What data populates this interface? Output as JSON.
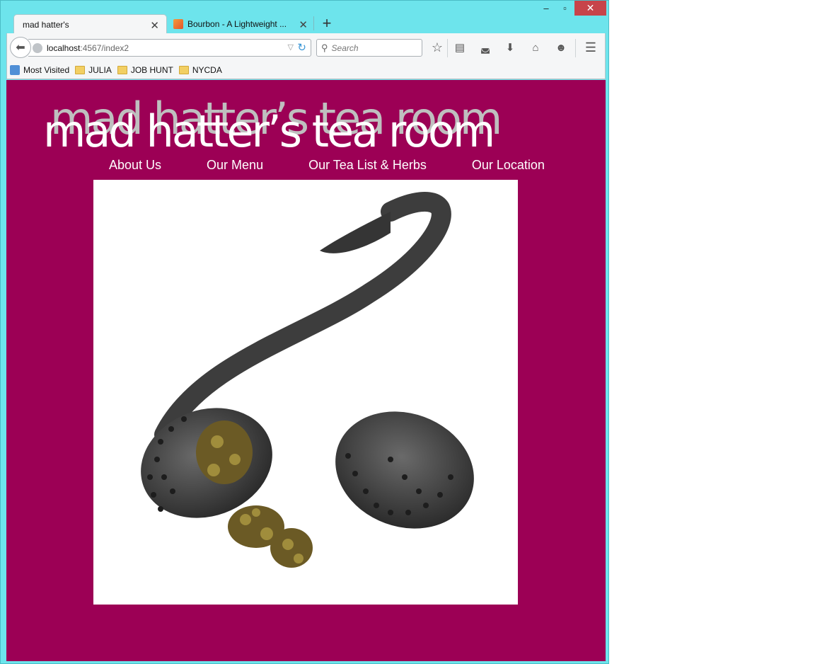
{
  "window": {
    "controls": {
      "minimize": "‒",
      "maximize": "▫",
      "close": "✕"
    }
  },
  "tabs": [
    {
      "title": "mad hatter's",
      "active": true
    },
    {
      "title": "Bourbon - A Lightweight ...",
      "active": false
    }
  ],
  "toolbar": {
    "url_host": "localhost",
    "url_path": ":4567/index2",
    "search_placeholder": "Search"
  },
  "bookmarks": [
    {
      "label": "Most Visited",
      "icon": "most-visited-icon"
    },
    {
      "label": "JULIA",
      "icon": "folder-icon"
    },
    {
      "label": "JOB HUNT",
      "icon": "folder-icon"
    },
    {
      "label": "NYCDA",
      "icon": "folder-icon"
    }
  ],
  "site": {
    "title": "mad hatter’s tea room",
    "nav": [
      "About Us",
      "Our Menu",
      "Our Tea List & Herbs",
      "Our Location"
    ],
    "colors": {
      "background": "#9c0055",
      "title": "#ffffff",
      "title_shadow": "#bfbfbf"
    }
  }
}
